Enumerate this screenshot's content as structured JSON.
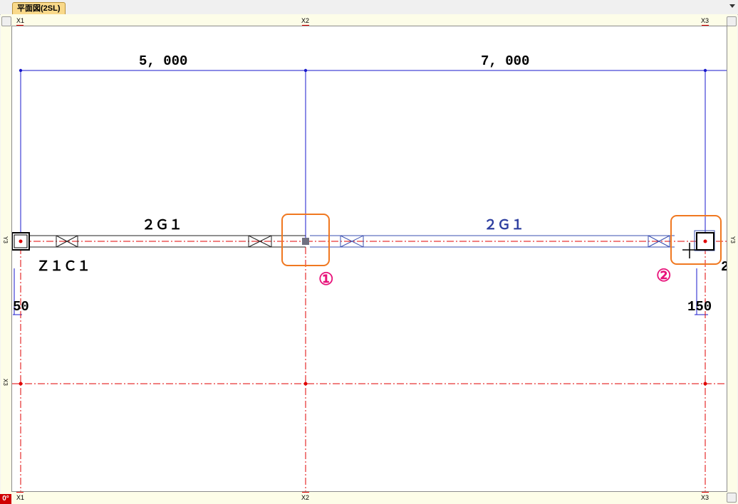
{
  "tab": {
    "label": "平面図(2SL)"
  },
  "rulers": {
    "top": [
      "X1",
      "X2",
      "X3"
    ],
    "bottom": [
      "X1",
      "X2",
      "X3"
    ],
    "left": [
      "Y3",
      "X3"
    ],
    "right": [
      "Y3"
    ]
  },
  "zero_indicator": "0°",
  "drawing": {
    "dims": [
      "5, 000",
      "7, 000"
    ],
    "beam_labels": [
      "２Ｇ１",
      "２Ｇ１"
    ],
    "column_label": "Ｚ１Ｃ１",
    "offsets": [
      "50",
      "150"
    ],
    "markers": [
      "①",
      "②"
    ],
    "partial_label": "2"
  },
  "colors": {
    "grid_line": "#1a1acc",
    "center_line": "#e00000",
    "highlight": "#f07820",
    "marker": "#e8127a",
    "selected_beam": "#2e3fa0"
  }
}
